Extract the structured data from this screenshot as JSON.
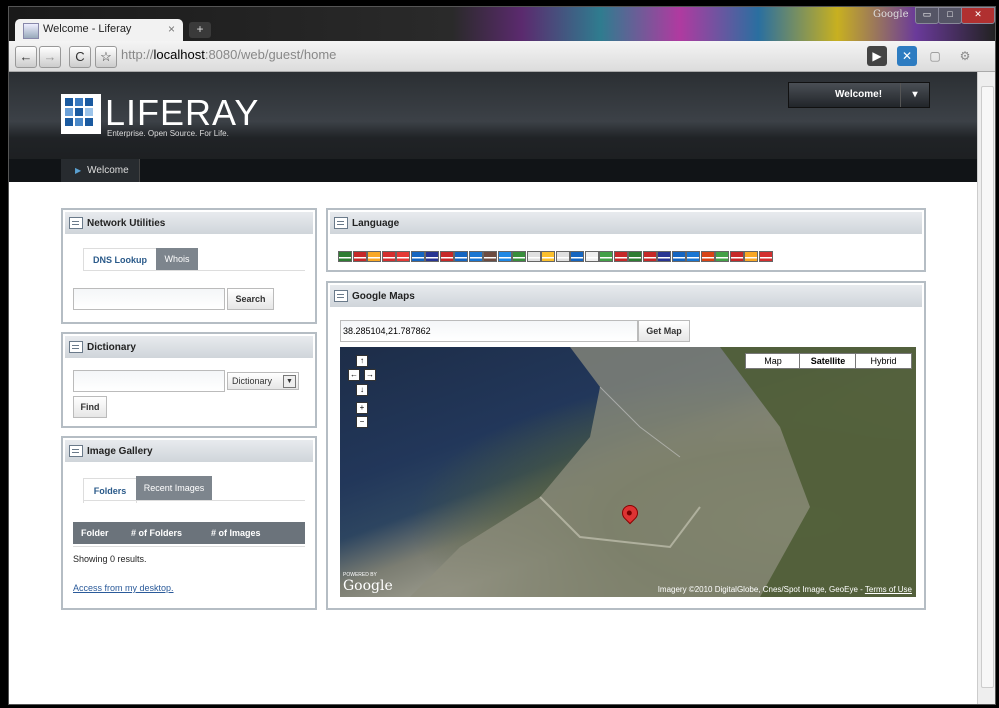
{
  "browser": {
    "tab_title": "Welcome - Liferay",
    "tab_close": "×",
    "new_tab": "+",
    "brand_tag": "Google",
    "url_scheme": "http://",
    "url_host": "localhost",
    "url_rest": ":8080/web/guest/home"
  },
  "header": {
    "logo_text": "LIFERAY",
    "logo_tagline": "Enterprise. Open Source. For Life.",
    "welcome_label": "Welcome!",
    "nav_item": "Welcome"
  },
  "network_utilities": {
    "title": "Network Utilities",
    "tab_dns": "DNS Lookup",
    "tab_whois": "Whois",
    "search_button": "Search"
  },
  "dictionary": {
    "title": "Dictionary",
    "select_value": "Dictionary",
    "find_button": "Find"
  },
  "image_gallery": {
    "title": "Image Gallery",
    "tab_folders": "Folders",
    "tab_recent": "Recent Images",
    "col_folder": "Folder",
    "col_folders": "# of Folders",
    "col_images": "# of Images",
    "results_text": "Showing 0 results.",
    "desktop_link": "Access from my desktop."
  },
  "language": {
    "title": "Language",
    "flag_colors": [
      "#2e7d32",
      "#c62828",
      "#f9a825",
      "#d32f2f",
      "#e53935",
      "#1565c0",
      "#283593",
      "#c62828",
      "#1565c0",
      "#1976d2",
      "#6d4c41",
      "#1e88e5",
      "#388e3c",
      "#e0e0e0",
      "#fbc02d",
      "#e0e0e0",
      "#1565c0",
      "#eeeeee",
      "#43a047",
      "#c62828",
      "#2e7d32",
      "#c62828",
      "#283593",
      "#1565c0",
      "#1976d2",
      "#d84315",
      "#43a047",
      "#c62828",
      "#f9a825",
      "#d32f2f"
    ]
  },
  "google_maps": {
    "title": "Google Maps",
    "coords_value": "38.285104,21.787862",
    "get_map_button": "Get Map",
    "map_types": [
      "Map",
      "Satellite",
      "Hybrid"
    ],
    "selected_map_type": "Satellite",
    "powered_by": "POWERED BY",
    "google_logo": "Google",
    "imagery_credit": "Imagery ©2010 DigitalGlobe, Cnes/Spot Image, GeoEye - ",
    "terms_link": "Terms of Use"
  }
}
